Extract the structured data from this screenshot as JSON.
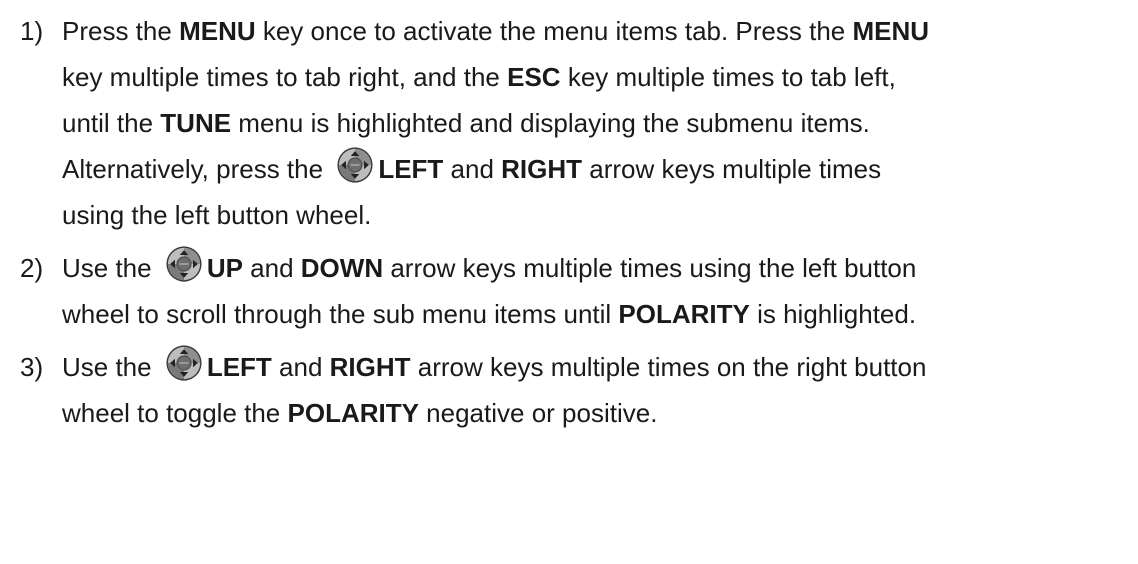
{
  "steps": [
    {
      "number": "1)",
      "lines": [
        {
          "t1": "Press the ",
          "b1": "MENU",
          "t2": " key once to activate the menu items tab.  Press the ",
          "b2": "MENU"
        },
        {
          "t1": "key multiple times to tab right, and the ",
          "b1": "ESC",
          "t2": " key multiple times to tab left,"
        },
        {
          "t1": "until the ",
          "b1": "TUNE",
          "t2": " menu is highlighted and displaying the submenu items."
        },
        {
          "t1": "Alternatively, press the ",
          "icon": "arrow-keypad-icon",
          "b1": "LEFT",
          "t2": " and ",
          "b2": "RIGHT",
          "t3": " arrow keys multiple times"
        },
        {
          "t1": "using the left button wheel."
        }
      ]
    },
    {
      "number": "2)",
      "lines": [
        {
          "t1": "Use the ",
          "icon": "arrow-keypad-icon",
          "b1": "UP",
          "t2": " and ",
          "b2": "DOWN",
          "t3": " arrow keys multiple times using the left button"
        },
        {
          "t1": "wheel to scroll through the sub menu items until ",
          "b1": "POLARITY",
          "t2": " is highlighted."
        }
      ]
    },
    {
      "number": "3)",
      "lines": [
        {
          "t1": "Use the ",
          "icon": "arrow-keypad-icon",
          "b1": "LEFT",
          "t2": " and ",
          "b2": "RIGHT",
          "t3": " arrow keys multiple times on the right button"
        },
        {
          "t1": "wheel to toggle the ",
          "b1": "POLARITY",
          "t2": " negative or positive."
        }
      ]
    }
  ],
  "icon_colors": {
    "ring": "#3a3a3a",
    "highlight": "#bdbdbd",
    "center": "#555555"
  }
}
